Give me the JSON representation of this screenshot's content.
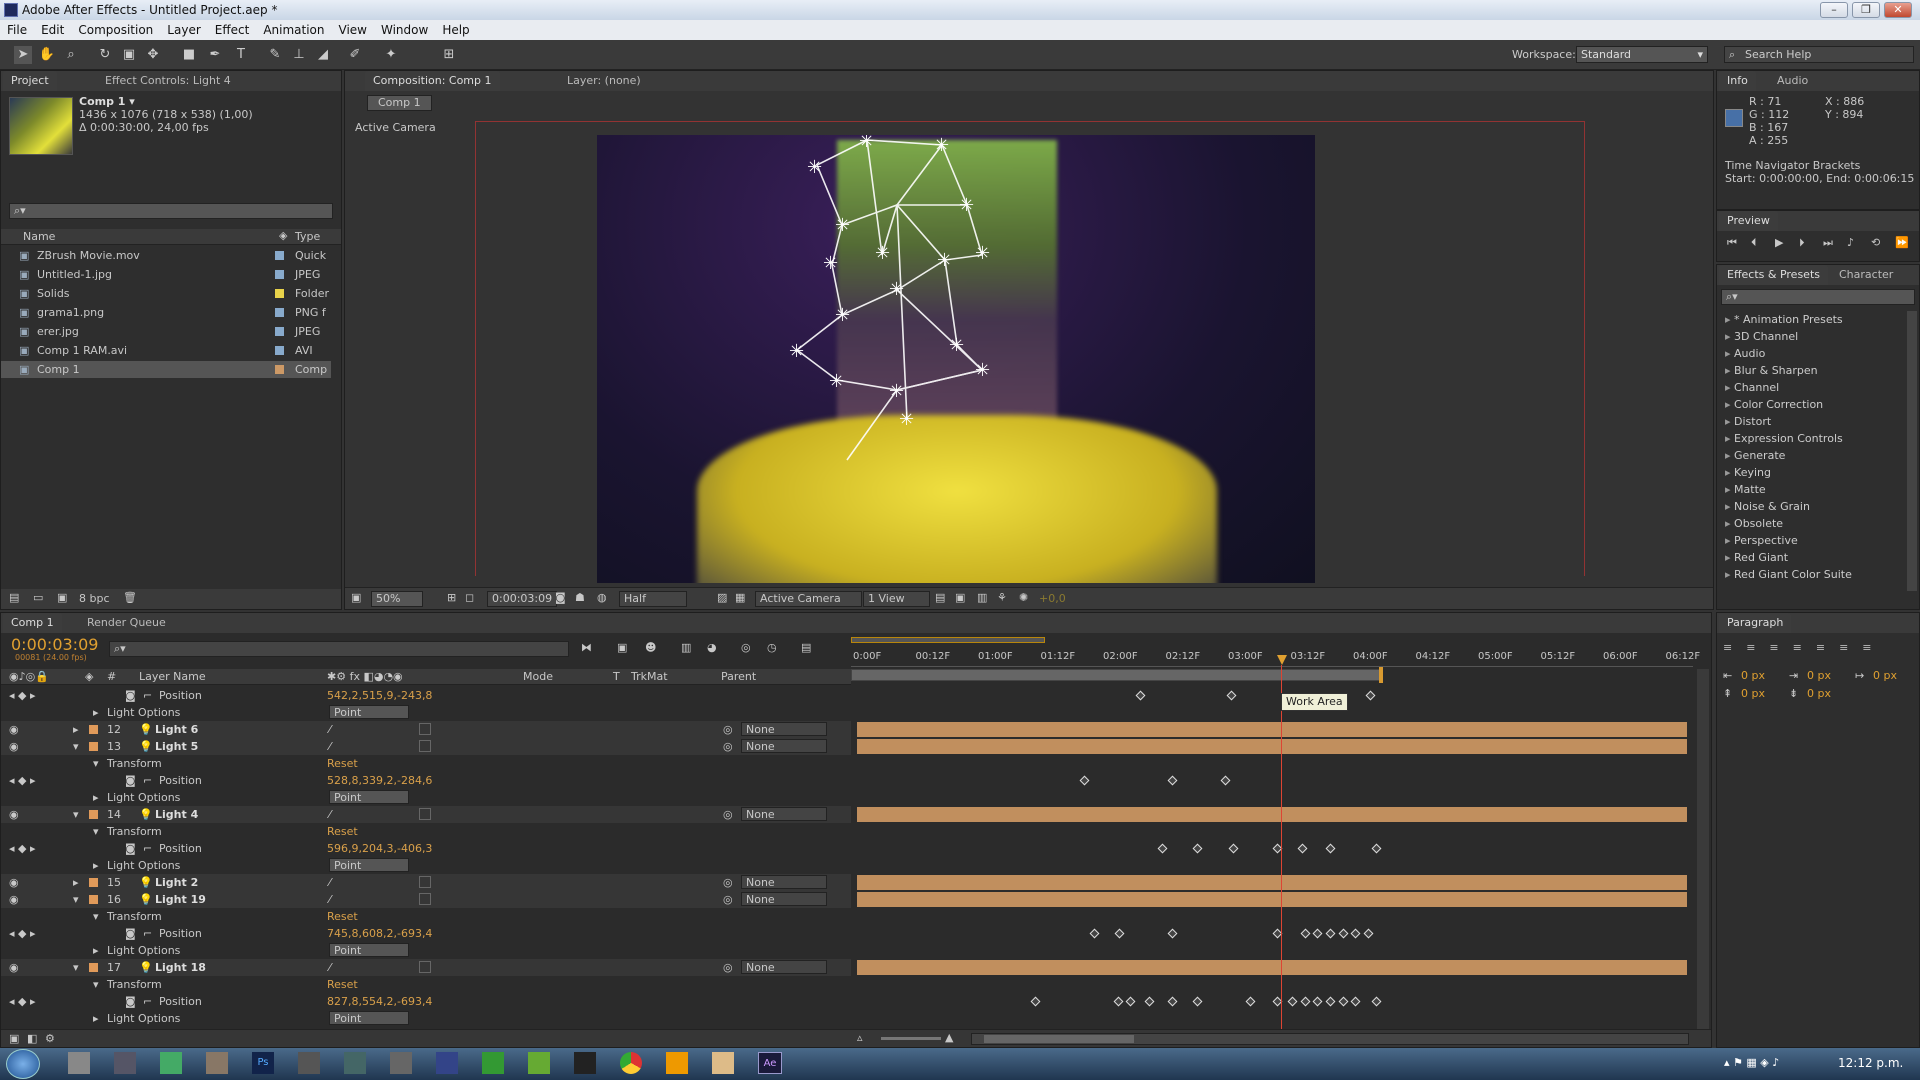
{
  "window": {
    "title": "Adobe After Effects - Untitled Project.aep *",
    "min": "–",
    "max": "❐",
    "close": "✕"
  },
  "menu": [
    "File",
    "Edit",
    "Composition",
    "Layer",
    "Effect",
    "Animation",
    "View",
    "Window",
    "Help"
  ],
  "workspace": {
    "label": "Workspace:",
    "value": "Standard",
    "search": "Search Help"
  },
  "project": {
    "tab": "Project",
    "effect_tab": "Effect Controls: Light 4",
    "comp_name": "Comp 1 ▾",
    "comp_info1": "1436 x 1076  (718 x 538) (1,00)",
    "comp_info2": "Δ 0:00:30:00, 24,00 fps",
    "col_name": "Name",
    "col_type": "Type",
    "bpc": "8 bpc",
    "items": [
      {
        "name": "ZBrush Movie.mov",
        "type": "Quick",
        "color": "#88aacc"
      },
      {
        "name": "Untitled-1.jpg",
        "type": "JPEG",
        "color": "#88aacc"
      },
      {
        "name": "Solids",
        "type": "Folder",
        "color": "#e8d24a"
      },
      {
        "name": "grama1.png",
        "type": "PNG f",
        "color": "#88aacc"
      },
      {
        "name": "erer.jpg",
        "type": "JPEG",
        "color": "#88aacc"
      },
      {
        "name": "Comp 1 RAM.avi",
        "type": "AVI",
        "color": "#88aacc"
      },
      {
        "name": "Comp 1",
        "type": "Comp",
        "color": "#cc9966"
      }
    ]
  },
  "composition": {
    "tab": "Composition: Comp 1",
    "layer_tab": "Layer: (none)",
    "crumb": "Comp 1",
    "camera_label": "Active Camera",
    "zoom": "50%",
    "time": "0:00:03:09",
    "resolution": "Half",
    "camera": "Active Camera",
    "views": "1 View",
    "offset": "+0,0"
  },
  "info": {
    "tab": "Info",
    "audio_tab": "Audio",
    "r": "R : 71",
    "g": "G : 112",
    "b": "B : 167",
    "a": "A : 255",
    "x": "X : 886",
    "y": "Y : 894",
    "nav_title": "Time Navigator Brackets",
    "nav_range": "Start: 0:00:00:00, End: 0:00:06:15",
    "swatch": "#4770a7"
  },
  "preview": {
    "tab": "Preview"
  },
  "effects": {
    "tab": "Effects & Presets",
    "char_tab": "Character",
    "items": [
      "* Animation Presets",
      "3D Channel",
      "Audio",
      "Blur & Sharpen",
      "Channel",
      "Color Correction",
      "Distort",
      "Expression Controls",
      "Generate",
      "Keying",
      "Matte",
      "Noise & Grain",
      "Obsolete",
      "Perspective",
      "Red Giant",
      "Red Giant Color Suite"
    ]
  },
  "paragraph": {
    "tab": "Paragraph",
    "v1": "0 px",
    "v2": "0 px",
    "v3": "0 px",
    "v4": "0 px",
    "v5": "0 px"
  },
  "timeline": {
    "tab": "Comp 1",
    "render_tab": "Render Queue",
    "time": "0:00:03:09",
    "frames": "00081 (24.00 fps)",
    "cols": {
      "num": "#",
      "layer": "Layer Name",
      "mode": "Mode",
      "t": "T",
      "trkmat": "TrkMat",
      "parent": "Parent"
    },
    "ruler": [
      "0:00F",
      "00:12F",
      "01:00F",
      "01:12F",
      "02:00F",
      "02:12F",
      "03:00F",
      "03:12F",
      "04:00F",
      "04:12F",
      "05:00F",
      "05:12F",
      "06:00F",
      "06:12F"
    ],
    "tooltip": "Work Area",
    "rows": [
      {
        "kind": "prop",
        "label": "Position",
        "value": "542,2,515,9,-243,8",
        "keys": [
          0.345,
          0.452,
          0.618
        ]
      },
      {
        "kind": "opt",
        "label": "Light Options",
        "value": "Point"
      },
      {
        "kind": "layer",
        "num": "12",
        "name": "Light 6",
        "open": false,
        "parent": "None"
      },
      {
        "kind": "layer",
        "num": "13",
        "name": "Light 5",
        "open": true,
        "parent": "None"
      },
      {
        "kind": "group",
        "label": "Transform",
        "value": "Reset"
      },
      {
        "kind": "prop",
        "label": "Position",
        "value": "528,8,339,2,-284,6",
        "keys": [
          0.278,
          0.383,
          0.445
        ]
      },
      {
        "kind": "opt",
        "label": "Light Options",
        "value": "Point"
      },
      {
        "kind": "layer",
        "num": "14",
        "name": "Light 4",
        "open": true,
        "parent": "None"
      },
      {
        "kind": "group",
        "label": "Transform",
        "value": "Reset"
      },
      {
        "kind": "prop",
        "label": "Position",
        "value": "596,9,204,3,-406,3",
        "keys": [
          0.37,
          0.412,
          0.455,
          0.507,
          0.537,
          0.57,
          0.625
        ]
      },
      {
        "kind": "opt",
        "label": "Light Options",
        "value": "Point"
      },
      {
        "kind": "layer",
        "num": "15",
        "name": "Light 2",
        "open": false,
        "parent": "None"
      },
      {
        "kind": "layer",
        "num": "16",
        "name": "Light 19",
        "open": true,
        "parent": "None"
      },
      {
        "kind": "group",
        "label": "Transform",
        "value": "Reset"
      },
      {
        "kind": "prop",
        "label": "Position",
        "value": "745,8,608,2,-693,4",
        "keys": [
          0.29,
          0.32,
          0.383,
          0.507,
          0.54,
          0.555,
          0.57,
          0.585,
          0.6,
          0.615
        ]
      },
      {
        "kind": "opt",
        "label": "Light Options",
        "value": "Point"
      },
      {
        "kind": "layer",
        "num": "17",
        "name": "Light 18",
        "open": true,
        "parent": "None"
      },
      {
        "kind": "group",
        "label": "Transform",
        "value": "Reset"
      },
      {
        "kind": "prop",
        "label": "Position",
        "value": "827,8,554,2,-693,4",
        "keys": [
          0.22,
          0.318,
          0.333,
          0.355,
          0.383,
          0.412,
          0.475,
          0.507,
          0.525,
          0.54,
          0.555,
          0.57,
          0.585,
          0.6,
          0.625
        ]
      },
      {
        "kind": "opt",
        "label": "Light Options",
        "value": "Point"
      }
    ]
  },
  "taskbar": {
    "clock": "12:12 p.m."
  }
}
